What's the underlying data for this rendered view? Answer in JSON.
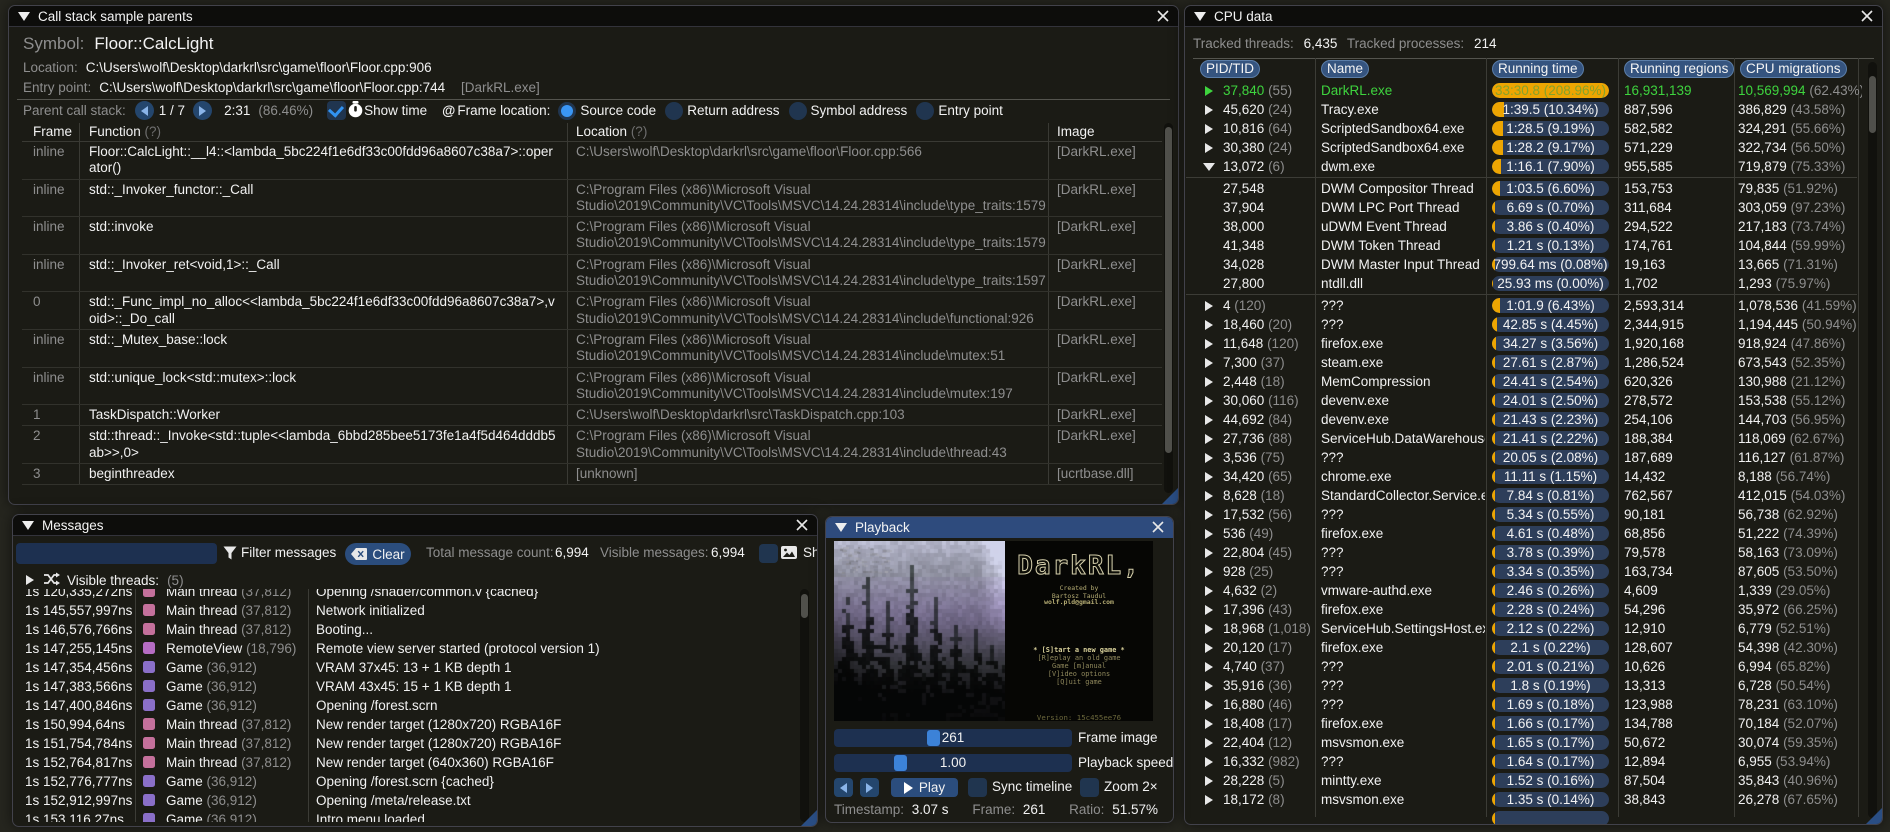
{
  "theme": {
    "accent_blue": "#4296fa",
    "title_active_bg": "#2e4b7d",
    "green": "#3ed43e",
    "orange": "#eda502",
    "bar_bg": "#2d3e5a",
    "thread_colors": {
      "main": "#c4709b",
      "remote": "#b56cc3",
      "game": "#8a6fc8"
    }
  },
  "callstack": {
    "title": "Call stack sample parents",
    "symbol_label": "Symbol:",
    "symbol": "Floor::CalcLight",
    "location_label": "Location:",
    "location": "C:\\Users\\wolf\\Desktop\\darkrl\\src\\game\\floor\\Floor.cpp:906",
    "entry_label": "Entry point:",
    "entry": "C:\\Users\\wolf\\Desktop\\darkrl\\src\\game\\floor\\Floor.cpp:744",
    "entry_image": "[DarkRL.exe]",
    "nav_label": "Parent call stack:",
    "nav_index": "1 / 7",
    "nav_time": "2:31",
    "nav_percent": "(86.46%)",
    "show_time_label": "Show time",
    "frame_location_label": "Frame location:",
    "at_icon": "@",
    "radio_options": [
      "Source code",
      "Return address",
      "Symbol address",
      "Entry point"
    ],
    "selected_option": "Source code",
    "help_marker": "(?)",
    "headers": {
      "frame": "Frame",
      "function": "Function",
      "location": "Location",
      "image": "Image"
    },
    "rows": [
      {
        "frame": "inline",
        "func": "Floor::CalcLight::__l4::<lambda_5bc224f1e6df33c00fdd96a8607c38a7>::operator()",
        "loc": "C:\\Users\\wolf\\Desktop\\darkrl\\src\\game\\floor\\Floor.cpp:566",
        "img": "[DarkRL.exe]"
      },
      {
        "frame": "inline",
        "func": "std::_Invoker_functor::_Call",
        "loc": "C:\\Program Files (x86)\\Microsoft Visual Studio\\2019\\Community\\VC\\Tools\\MSVC\\14.24.28314\\include\\type_traits:1579",
        "img": "[DarkRL.exe]"
      },
      {
        "frame": "inline",
        "func": "std::invoke",
        "loc": "C:\\Program Files (x86)\\Microsoft Visual Studio\\2019\\Community\\VC\\Tools\\MSVC\\14.24.28314\\include\\type_traits:1579",
        "img": "[DarkRL.exe]"
      },
      {
        "frame": "inline",
        "func": "std::_Invoker_ret<void,1>::_Call",
        "loc": "C:\\Program Files (x86)\\Microsoft Visual Studio\\2019\\Community\\VC\\Tools\\MSVC\\14.24.28314\\include\\type_traits:1597",
        "img": "[DarkRL.exe]"
      },
      {
        "frame": "0",
        "func": "std::_Func_impl_no_alloc<<lambda_5bc224f1e6df33c00fdd96a8607c38a7>,void>::_Do_call",
        "loc": "C:\\Program Files (x86)\\Microsoft Visual Studio\\2019\\Community\\VC\\Tools\\MSVC\\14.24.28314\\include\\functional:926",
        "img": "[DarkRL.exe]"
      },
      {
        "frame": "inline",
        "func": "std::_Mutex_base::lock",
        "loc": "C:\\Program Files (x86)\\Microsoft Visual Studio\\2019\\Community\\VC\\Tools\\MSVC\\14.24.28314\\include\\mutex:51",
        "img": "[DarkRL.exe]"
      },
      {
        "frame": "inline",
        "func": "std::unique_lock<std::mutex>::lock",
        "loc": "C:\\Program Files (x86)\\Microsoft Visual Studio\\2019\\Community\\VC\\Tools\\MSVC\\14.24.28314\\include\\mutex:197",
        "img": "[DarkRL.exe]"
      },
      {
        "frame": "1",
        "func": "TaskDispatch::Worker",
        "loc": "C:\\Users\\wolf\\Desktop\\darkrl\\src\\TaskDispatch.cpp:103",
        "img": "[DarkRL.exe]"
      },
      {
        "frame": "2",
        "func": "std::thread::_Invoke<std::tuple<<lambda_6bbd285bee5173fe1a4f5d464dddb5ab>>,0>",
        "loc": "C:\\Program Files (x86)\\Microsoft Visual Studio\\2019\\Community\\VC\\Tools\\MSVC\\14.24.28314\\include\\thread:43",
        "img": "[DarkRL.exe]"
      },
      {
        "frame": "3",
        "func": "beginthreadex",
        "loc": "[unknown]",
        "img": "[ucrtbase.dll]"
      }
    ]
  },
  "cpu": {
    "title": "CPU data",
    "tracked_threads_label": "Tracked threads:",
    "tracked_threads": "6,435",
    "tracked_processes_label": "Tracked processes:",
    "tracked_processes": "214",
    "columns": [
      "PID/TID",
      "Name",
      "Running time",
      "Running regions",
      "CPU migrations"
    ],
    "rows": [
      {
        "tri": "collapsed",
        "pid": "37,840",
        "count": "(55)",
        "name": "DarkRL.exe",
        "time": "33:30.8 (208.96%)",
        "pct": 208.96,
        "regions": "16,931,139",
        "migrations": "10,569,994",
        "mig_pct": "(62.43%)",
        "green": true
      },
      {
        "tri": "collapsed",
        "pid": "45,620",
        "count": "(24)",
        "name": "Tracy.exe",
        "time": "1:39.5 (10.34%)",
        "pct": 10.34,
        "regions": "887,596",
        "migrations": "386,829",
        "mig_pct": "(43.58%)"
      },
      {
        "tri": "collapsed",
        "pid": "10,816",
        "count": "(64)",
        "name": "ScriptedSandbox64.exe",
        "time": "1:28.5 (9.19%)",
        "pct": 9.19,
        "regions": "582,582",
        "migrations": "324,291",
        "mig_pct": "(55.66%)"
      },
      {
        "tri": "collapsed",
        "pid": "30,380",
        "count": "(24)",
        "name": "ScriptedSandbox64.exe",
        "time": "1:28.2 (9.17%)",
        "pct": 9.17,
        "regions": "571,229",
        "migrations": "322,734",
        "mig_pct": "(56.50%)"
      },
      {
        "tri": "expanded",
        "pid": "13,072",
        "count": "(6)",
        "name": "dwm.exe",
        "time": "1:16.1 (7.90%)",
        "pct": 7.9,
        "regions": "955,585",
        "migrations": "719,879",
        "mig_pct": "(75.33%)"
      },
      {
        "sep": true
      },
      {
        "pid": "27,548",
        "name": "DWM Compositor Thread",
        "time": "1:03.5 (6.60%)",
        "pct": 6.6,
        "regions": "153,753",
        "migrations": "79,835",
        "mig_pct": "(51.92%)"
      },
      {
        "pid": "37,904",
        "name": "DWM LPC Port Thread",
        "time": "6.69 s (0.70%)",
        "pct": 0.7,
        "regions": "311,684",
        "migrations": "303,059",
        "mig_pct": "(97.23%)"
      },
      {
        "pid": "38,000",
        "name": "uDWM Event Thread",
        "time": "3.86 s (0.40%)",
        "pct": 0.4,
        "regions": "294,522",
        "migrations": "217,183",
        "mig_pct": "(73.74%)"
      },
      {
        "pid": "41,348",
        "name": "DWM Token Thread",
        "time": "1.21 s (0.13%)",
        "pct": 0.13,
        "regions": "174,761",
        "migrations": "104,844",
        "mig_pct": "(59.99%)"
      },
      {
        "pid": "34,028",
        "name": "DWM Master Input Thread",
        "time": "799.64 ms (0.08%)",
        "pct": 0.08,
        "regions": "19,163",
        "migrations": "13,665",
        "mig_pct": "(71.31%)"
      },
      {
        "pid": "27,800",
        "name": "ntdll.dll",
        "time": "25.93 ms (0.00%)",
        "pct": 0.0,
        "regions": "1,702",
        "migrations": "1,293",
        "mig_pct": "(75.97%)"
      },
      {
        "sep": true
      },
      {
        "tri": "collapsed",
        "pid": "4",
        "count": "(120)",
        "name": "???",
        "time": "1:01.9 (6.43%)",
        "pct": 6.43,
        "regions": "2,593,314",
        "migrations": "1,078,536",
        "mig_pct": "(41.59%)"
      },
      {
        "tri": "collapsed",
        "pid": "18,460",
        "count": "(20)",
        "name": "???",
        "time": "42.85 s (4.45%)",
        "pct": 4.45,
        "regions": "2,344,915",
        "migrations": "1,194,445",
        "mig_pct": "(50.94%)"
      },
      {
        "tri": "collapsed",
        "pid": "11,648",
        "count": "(120)",
        "name": "firefox.exe",
        "time": "34.27 s (3.56%)",
        "pct": 3.56,
        "regions": "1,920,168",
        "migrations": "918,924",
        "mig_pct": "(47.86%)"
      },
      {
        "tri": "collapsed",
        "pid": "7,300",
        "count": "(37)",
        "name": "steam.exe",
        "time": "27.61 s (2.87%)",
        "pct": 2.87,
        "regions": "1,286,524",
        "migrations": "673,543",
        "mig_pct": "(52.35%)"
      },
      {
        "tri": "collapsed",
        "pid": "2,448",
        "count": "(18)",
        "name": "MemCompression",
        "time": "24.41 s (2.54%)",
        "pct": 2.54,
        "regions": "620,326",
        "migrations": "130,988",
        "mig_pct": "(21.12%)"
      },
      {
        "tri": "collapsed",
        "pid": "30,060",
        "count": "(116)",
        "name": "devenv.exe",
        "time": "24.01 s (2.50%)",
        "pct": 2.5,
        "regions": "278,572",
        "migrations": "153,538",
        "mig_pct": "(55.12%)"
      },
      {
        "tri": "collapsed",
        "pid": "44,692",
        "count": "(84)",
        "name": "devenv.exe",
        "time": "21.43 s (2.23%)",
        "pct": 2.23,
        "regions": "254,106",
        "migrations": "144,703",
        "mig_pct": "(56.95%)"
      },
      {
        "tri": "collapsed",
        "pid": "27,736",
        "count": "(88)",
        "name": "ServiceHub.DataWarehouseHost.exe",
        "time": "21.41 s (2.22%)",
        "pct": 2.22,
        "regions": "188,384",
        "migrations": "118,069",
        "mig_pct": "(62.67%)"
      },
      {
        "tri": "collapsed",
        "pid": "3,536",
        "count": "(75)",
        "name": "???",
        "time": "20.05 s (2.08%)",
        "pct": 2.08,
        "regions": "187,689",
        "migrations": "116,127",
        "mig_pct": "(61.87%)"
      },
      {
        "tri": "collapsed",
        "pid": "34,420",
        "count": "(65)",
        "name": "chrome.exe",
        "time": "11.11 s (1.15%)",
        "pct": 1.15,
        "regions": "14,432",
        "migrations": "8,188",
        "mig_pct": "(56.74%)"
      },
      {
        "tri": "collapsed",
        "pid": "8,628",
        "count": "(18)",
        "name": "StandardCollector.Service.exe",
        "time": "7.84 s (0.81%)",
        "pct": 0.81,
        "regions": "762,567",
        "migrations": "412,015",
        "mig_pct": "(54.03%)"
      },
      {
        "tri": "collapsed",
        "pid": "17,532",
        "count": "(56)",
        "name": "???",
        "time": "5.34 s (0.55%)",
        "pct": 0.55,
        "regions": "90,181",
        "migrations": "56,738",
        "mig_pct": "(62.92%)"
      },
      {
        "tri": "collapsed",
        "pid": "536",
        "count": "(49)",
        "name": "firefox.exe",
        "time": "4.61 s (0.48%)",
        "pct": 0.48,
        "regions": "68,856",
        "migrations": "51,222",
        "mig_pct": "(74.39%)"
      },
      {
        "tri": "collapsed",
        "pid": "22,804",
        "count": "(45)",
        "name": "???",
        "time": "3.78 s (0.39%)",
        "pct": 0.39,
        "regions": "79,578",
        "migrations": "58,163",
        "mig_pct": "(73.09%)"
      },
      {
        "tri": "collapsed",
        "pid": "928",
        "count": "(25)",
        "name": "???",
        "time": "3.34 s (0.35%)",
        "pct": 0.35,
        "regions": "163,734",
        "migrations": "87,605",
        "mig_pct": "(53.50%)"
      },
      {
        "tri": "collapsed",
        "pid": "4,632",
        "count": "(2)",
        "name": "vmware-authd.exe",
        "time": "2.46 s (0.26%)",
        "pct": 0.26,
        "regions": "4,609",
        "migrations": "1,339",
        "mig_pct": "(29.05%)"
      },
      {
        "tri": "collapsed",
        "pid": "17,396",
        "count": "(43)",
        "name": "firefox.exe",
        "time": "2.28 s (0.24%)",
        "pct": 0.24,
        "regions": "54,296",
        "migrations": "35,972",
        "mig_pct": "(66.25%)"
      },
      {
        "tri": "collapsed",
        "pid": "18,968",
        "count": "(1,018)",
        "name": "ServiceHub.SettingsHost.exe",
        "time": "2.12 s (0.22%)",
        "pct": 0.22,
        "regions": "12,910",
        "migrations": "6,779",
        "mig_pct": "(52.51%)"
      },
      {
        "tri": "collapsed",
        "pid": "20,120",
        "count": "(17)",
        "name": "firefox.exe",
        "time": "2.1 s (0.22%)",
        "pct": 0.22,
        "regions": "128,607",
        "migrations": "54,398",
        "mig_pct": "(42.30%)"
      },
      {
        "tri": "collapsed",
        "pid": "4,740",
        "count": "(37)",
        "name": "???",
        "time": "2.01 s (0.21%)",
        "pct": 0.21,
        "regions": "10,626",
        "migrations": "6,994",
        "mig_pct": "(65.82%)"
      },
      {
        "tri": "collapsed",
        "pid": "35,916",
        "count": "(36)",
        "name": "???",
        "time": "1.8 s (0.19%)",
        "pct": 0.19,
        "regions": "13,313",
        "migrations": "6,728",
        "mig_pct": "(50.54%)"
      },
      {
        "tri": "collapsed",
        "pid": "16,880",
        "count": "(46)",
        "name": "???",
        "time": "1.69 s (0.18%)",
        "pct": 0.18,
        "regions": "123,988",
        "migrations": "78,231",
        "mig_pct": "(63.10%)"
      },
      {
        "tri": "collapsed",
        "pid": "18,408",
        "count": "(17)",
        "name": "firefox.exe",
        "time": "1.66 s (0.17%)",
        "pct": 0.17,
        "regions": "134,788",
        "migrations": "70,184",
        "mig_pct": "(52.07%)"
      },
      {
        "tri": "collapsed",
        "pid": "22,404",
        "count": "(12)",
        "name": "msvsmon.exe",
        "time": "1.65 s (0.17%)",
        "pct": 0.17,
        "regions": "50,672",
        "migrations": "30,074",
        "mig_pct": "(59.35%)"
      },
      {
        "tri": "collapsed",
        "pid": "16,332",
        "count": "(982)",
        "name": "???",
        "time": "1.64 s (0.17%)",
        "pct": 0.17,
        "regions": "12,894",
        "migrations": "6,955",
        "mig_pct": "(53.94%)"
      },
      {
        "tri": "collapsed",
        "pid": "28,228",
        "count": "(5)",
        "name": "mintty.exe",
        "time": "1.52 s (0.16%)",
        "pct": 0.16,
        "regions": "87,504",
        "migrations": "35,843",
        "mig_pct": "(40.96%)"
      },
      {
        "tri": "collapsed",
        "pid": "18,172",
        "count": "(8)",
        "name": "msvsmon.exe",
        "time": "1.35 s (0.14%)",
        "pct": 0.14,
        "regions": "38,843",
        "migrations": "26,278",
        "mig_pct": "(67.65%)"
      },
      {
        "pid": "",
        "count": "",
        "name": "",
        "time": "",
        "pct": 0.1,
        "regions": "",
        "migrations": "",
        "mig_pct": ""
      }
    ]
  },
  "messages": {
    "title": "Messages",
    "filter_placeholder": "",
    "filter_label": "Filter messages",
    "clear_label": "Clear",
    "total_label": "Total message count:",
    "total_value": "6,994",
    "visible_label": "Visible messages:",
    "visible_value": "6,994",
    "show_images_label": "Show frame images",
    "threads_label": "Visible threads:",
    "threads_count": "(5)",
    "rows": [
      {
        "time": "1s 120,335,272ns",
        "thread": "Main thread",
        "tid": "(37,812)",
        "color": "#c4709b",
        "text": "Opening /shader/common.v {cached}"
      },
      {
        "time": "1s 145,557,997ns",
        "thread": "Main thread",
        "tid": "(37,812)",
        "color": "#c4709b",
        "text": "Network initialized"
      },
      {
        "time": "1s 146,576,766ns",
        "thread": "Main thread",
        "tid": "(37,812)",
        "color": "#c4709b",
        "text": "Booting..."
      },
      {
        "time": "1s 147,255,145ns",
        "thread": "RemoteView",
        "tid": "(18,796)",
        "color": "#b56cc3",
        "text": "Remote view server started (protocol version 1)"
      },
      {
        "time": "1s 147,354,456ns",
        "thread": "Game",
        "tid": "(36,912)",
        "color": "#8a6fc8",
        "text": "VRAM 37x45: 13 + 1 KB   depth 1"
      },
      {
        "time": "1s 147,383,566ns",
        "thread": "Game",
        "tid": "(36,912)",
        "color": "#8a6fc8",
        "text": "VRAM 43x45: 15 + 1 KB   depth 1"
      },
      {
        "time": "1s 147,400,846ns",
        "thread": "Game",
        "tid": "(36,912)",
        "color": "#8a6fc8",
        "text": "Opening /forest.scrn"
      },
      {
        "time": "1s 150,994,64ns",
        "thread": "Main thread",
        "tid": "(37,812)",
        "color": "#c4709b",
        "text": "New render target (1280x720) RGBA16F"
      },
      {
        "time": "1s 151,754,784ns",
        "thread": "Main thread",
        "tid": "(37,812)",
        "color": "#c4709b",
        "text": "New render target (1280x720) RGBA16F"
      },
      {
        "time": "1s 152,764,817ns",
        "thread": "Main thread",
        "tid": "(37,812)",
        "color": "#c4709b",
        "text": "New render target (640x360) RGBA16F"
      },
      {
        "time": "1s 152,776,777ns",
        "thread": "Game",
        "tid": "(36,912)",
        "color": "#8a6fc8",
        "text": "Opening /forest.scrn {cached}"
      },
      {
        "time": "1s 152,912,997ns",
        "thread": "Game",
        "tid": "(36,912)",
        "color": "#8a6fc8",
        "text": "Opening /meta/release.txt"
      },
      {
        "time": "1s 153,116,27ns",
        "thread": "Game",
        "tid": "(36,912)",
        "color": "#8a6fc8",
        "text": "Intro menu loaded"
      }
    ]
  },
  "playback": {
    "title": "Playback",
    "frame_image_value": "261",
    "frame_image_label": "Frame image",
    "speed_value": "1.00",
    "speed_label": "Playback speed",
    "play_label": "Play",
    "sync_label": "Sync timeline",
    "zoom_label": "Zoom 2×",
    "timestamp_label": "Timestamp:",
    "timestamp_value": "3.07 s",
    "frame_label": "Frame:",
    "frame_value": "261",
    "ratio_label": "Ratio:",
    "ratio_value": "51.57%",
    "game_menu": {
      "logo": "DarkRL,",
      "credits": [
        "Created by",
        "Bartosz Taudul",
        "wolf.pld@gmail.com"
      ],
      "items": [
        "* [S]tart a new game *",
        "[R]eplay an old game",
        "Game [m]anual",
        "[V]ideo options",
        "[Q]uit game"
      ],
      "version": "Version: 15c455ee76"
    }
  }
}
